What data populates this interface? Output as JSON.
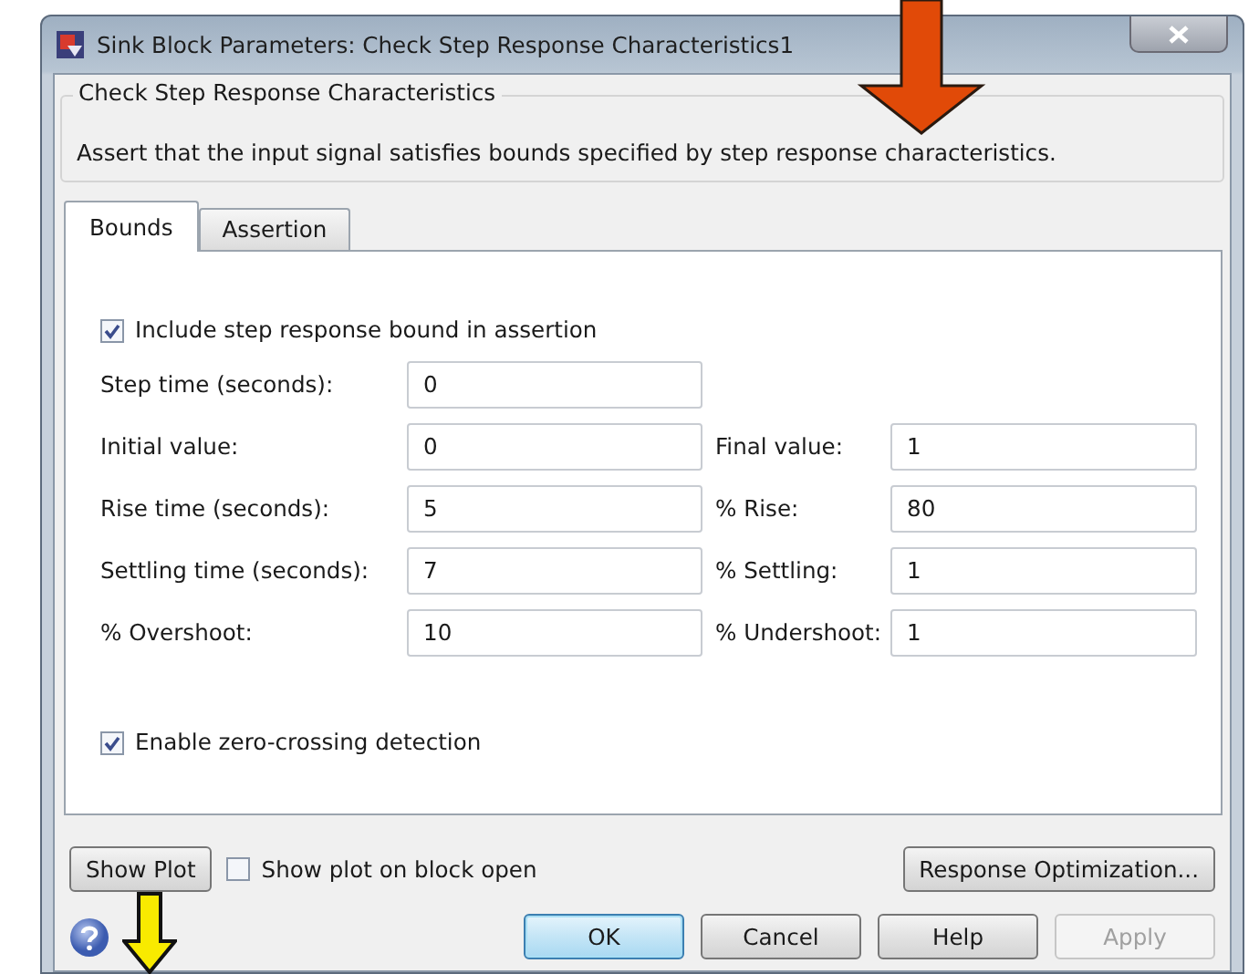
{
  "window": {
    "title": "Sink Block Parameters: Check Step Response Characteristics1"
  },
  "group": {
    "title": "Check Step Response Characteristics",
    "description": "Assert that the input signal satisfies bounds specified by step response characteristics."
  },
  "tabs": [
    {
      "label": "Bounds",
      "selected": true
    },
    {
      "label": "Assertion",
      "selected": false
    }
  ],
  "include_bound": {
    "label": "Include step response bound in assertion",
    "checked": true
  },
  "rows": [
    {
      "left": {
        "label": "Step time (seconds):",
        "value": "0"
      }
    },
    {
      "left": {
        "label": "Initial value:",
        "value": "0"
      },
      "right": {
        "label": "Final value:",
        "value": "1"
      }
    },
    {
      "left": {
        "label": "Rise time (seconds):",
        "value": "5"
      },
      "right": {
        "label": "% Rise:",
        "value": "80"
      }
    },
    {
      "left": {
        "label": "Settling time (seconds):",
        "value": "7"
      },
      "right": {
        "label": "% Settling:",
        "value": "1"
      }
    },
    {
      "left": {
        "label": "% Overshoot:",
        "value": "10"
      },
      "right": {
        "label": "% Undershoot:",
        "value": "1"
      }
    }
  ],
  "zero_crossing": {
    "label": "Enable zero-crossing detection",
    "checked": true
  },
  "show_plot_button": "Show Plot",
  "show_plot_on_open": {
    "label": "Show plot on block open",
    "checked": false
  },
  "response_optimization_button": "Response Optimization...",
  "buttons": [
    {
      "label": "OK",
      "default": true,
      "disabled": false
    },
    {
      "label": "Cancel",
      "default": false,
      "disabled": false
    },
    {
      "label": "Help",
      "default": false,
      "disabled": false
    },
    {
      "label": "Apply",
      "default": false,
      "disabled": true
    }
  ]
}
